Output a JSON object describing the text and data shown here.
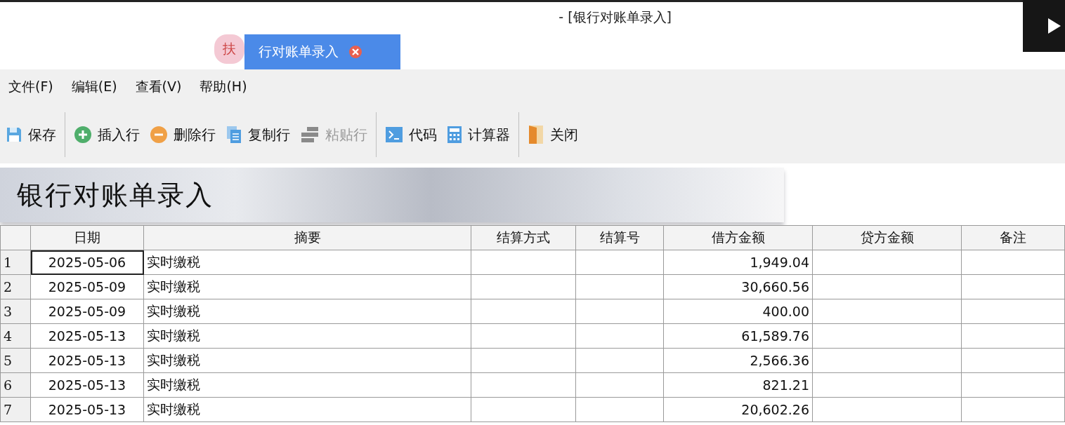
{
  "window": {
    "title": "- [银行对账单录入]"
  },
  "tabs": [
    {
      "label": "扶",
      "selected": false,
      "closable": false
    },
    {
      "label": "行对账单录入",
      "selected": true,
      "closable": true
    }
  ],
  "menu": [
    "文件(F)",
    "编辑(E)",
    "查看(V)",
    "帮助(H)"
  ],
  "toolbar": [
    {
      "kind": "save",
      "label": "保存",
      "disabled": false,
      "separator_before": false
    },
    {
      "kind": "insert",
      "label": "插入行",
      "disabled": false,
      "separator_before": true
    },
    {
      "kind": "delete",
      "label": "删除行",
      "disabled": false,
      "separator_before": false
    },
    {
      "kind": "copy",
      "label": "复制行",
      "disabled": false,
      "separator_before": false
    },
    {
      "kind": "paste",
      "label": "粘贴行",
      "disabled": true,
      "separator_before": false
    },
    {
      "kind": "code",
      "label": "代码",
      "disabled": false,
      "separator_before": true
    },
    {
      "kind": "calc",
      "label": "计算器",
      "disabled": false,
      "separator_before": false
    },
    {
      "kind": "close",
      "label": "关闭",
      "disabled": false,
      "separator_before": true
    }
  ],
  "banner": {
    "title": "银行对账单录入"
  },
  "table": {
    "columns": [
      "日期",
      "摘要",
      "结算方式",
      "结算号",
      "借方金额",
      "贷方金额",
      "备注"
    ],
    "rows": [
      {
        "number": "1",
        "date": "2025-05-06",
        "summary": "实时缴税",
        "debit": "1,949.04",
        "selected": true
      },
      {
        "number": "2",
        "date": "2025-05-09",
        "summary": "实时缴税",
        "debit": "30,660.56",
        "selected": false
      },
      {
        "number": "3",
        "date": "2025-05-09",
        "summary": "实时缴税",
        "debit": "400.00",
        "selected": false
      },
      {
        "number": "4",
        "date": "2025-05-13",
        "summary": "实时缴税",
        "debit": "61,589.76",
        "selected": false
      },
      {
        "number": "5",
        "date": "2025-05-13",
        "summary": "实时缴税",
        "debit": "2,566.36",
        "selected": false
      },
      {
        "number": "6",
        "date": "2025-05-13",
        "summary": "实时缴税",
        "debit": "821.21",
        "selected": false
      },
      {
        "number": "7",
        "date": "2025-05-13",
        "summary": "实时缴税",
        "debit": "20,602.26",
        "selected": false
      }
    ]
  }
}
